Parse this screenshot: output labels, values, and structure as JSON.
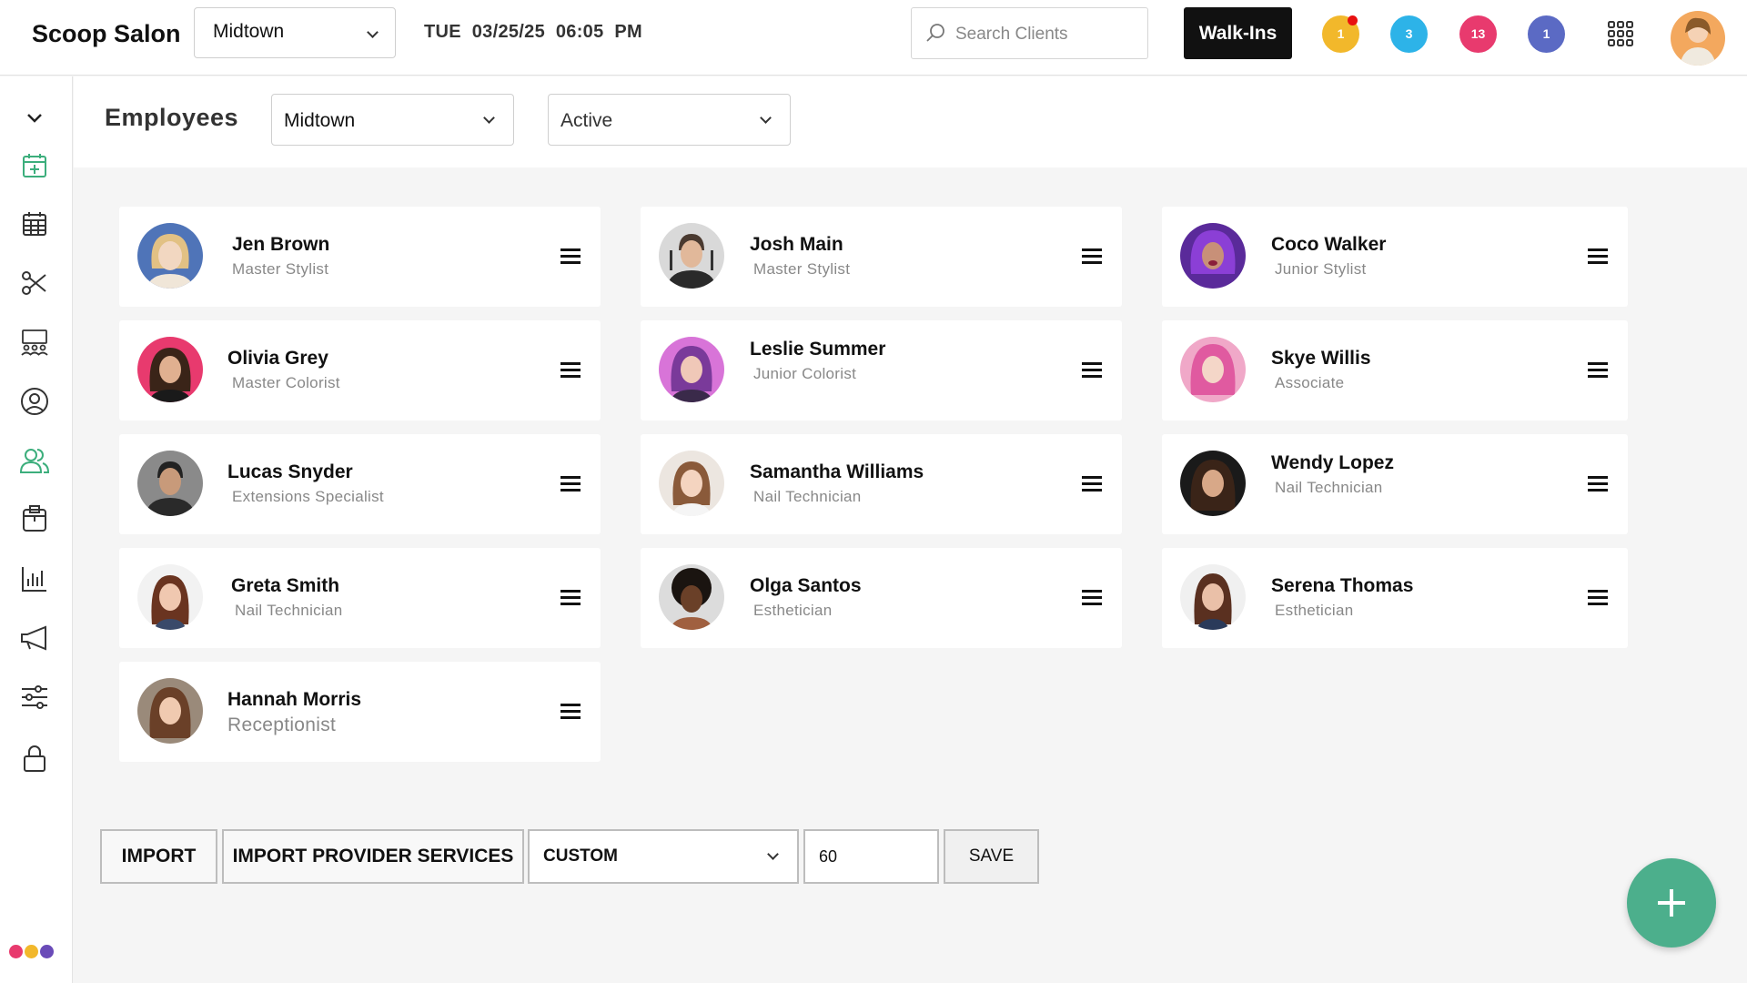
{
  "header": {
    "brand": "Scoop Salon",
    "location": "Midtown",
    "date": "TUE 03/25/25",
    "time": "06:05 PM",
    "search_placeholder": "Search Clients",
    "walkins_label": "Walk-Ins",
    "badges": [
      {
        "count": "1",
        "color": "#f2b82b"
      },
      {
        "count": "3",
        "color": "#2db3e8"
      },
      {
        "count": "13",
        "color": "#e83a6e"
      },
      {
        "count": "1",
        "color": "#5b6ac4"
      }
    ]
  },
  "page": {
    "title": "Employees",
    "location_filter": "Midtown",
    "status_filter": "Active"
  },
  "employees": [
    {
      "name": "Jen Brown",
      "role": "Master Stylist"
    },
    {
      "name": "Josh Main",
      "role": "Master Stylist"
    },
    {
      "name": "Coco Walker",
      "role": "Junior Stylist"
    },
    {
      "name": "Olivia Grey",
      "role": "Master Colorist"
    },
    {
      "name": "Leslie Summer",
      "role": "Junior Colorist"
    },
    {
      "name": "Skye Willis",
      "role": "Associate"
    },
    {
      "name": "Lucas Snyder",
      "role": "Extensions Specialist"
    },
    {
      "name": "Samantha Williams",
      "role": "Nail Technician"
    },
    {
      "name": "Wendy Lopez",
      "role": "Nail Technician"
    },
    {
      "name": "Greta Smith",
      "role": "Nail Technician"
    },
    {
      "name": "Olga Santos",
      "role": "Esthetician"
    },
    {
      "name": "Serena Thomas",
      "role": "Esthetician"
    },
    {
      "name": "Hannah Morris",
      "role": "Receptionist"
    }
  ],
  "toolbar": {
    "import_label": "IMPORT",
    "import_services_label": "IMPORT PROVIDER SERVICES",
    "custom_select": "CUSTOM",
    "number_value": "60",
    "save_label": "SAVE"
  },
  "colors": {
    "accent_green": "#4caf8c",
    "sidebar_active": "#3cae7c"
  }
}
